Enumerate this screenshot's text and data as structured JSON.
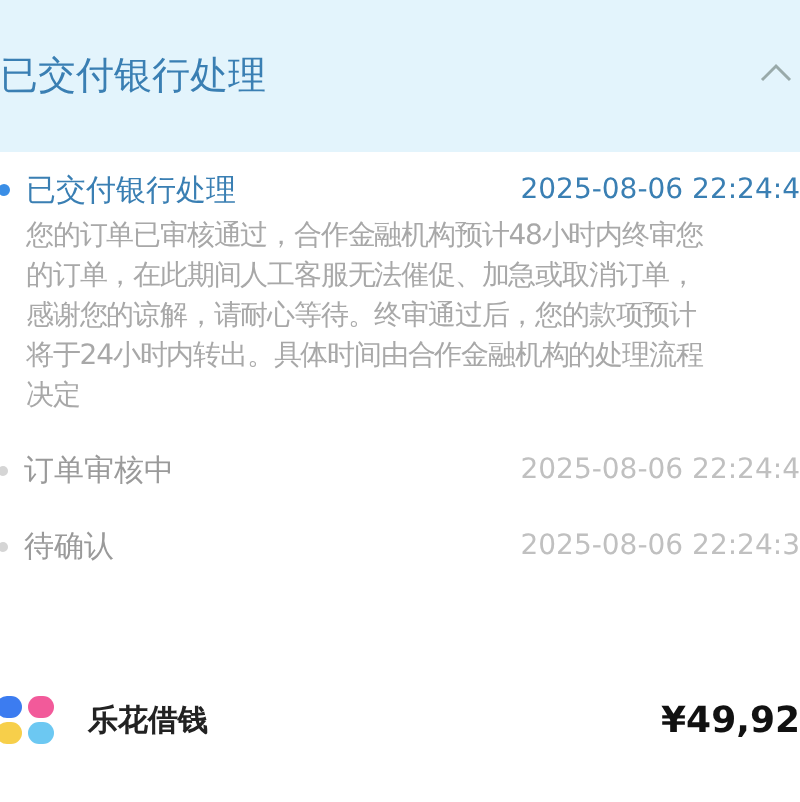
{
  "header": {
    "title": "已交付银行处理",
    "expanded": true
  },
  "timeline": [
    {
      "title": "已交付银行处理",
      "time": "2025-08-06 22:24:4",
      "selected": true,
      "description": [
        "您的订单已审核通过，合作金融机构预计48小时内终审您",
        "的订单，在此期间人工客服无法催促、加急或取消订单，",
        "感谢您的谅解，请耐心等待。终审通过后，您的款项预计",
        "将于24小时内转出。具体时间由合作金融机构的处理流程",
        "决定"
      ]
    },
    {
      "title": "订单审核中",
      "time": "2025-08-06 22:24:4",
      "selected": false
    },
    {
      "title": "待确认",
      "time": "2025-08-06 22:24:3",
      "selected": false
    }
  ],
  "lender": {
    "name": "乐花借钱",
    "amount": "¥49,92"
  }
}
